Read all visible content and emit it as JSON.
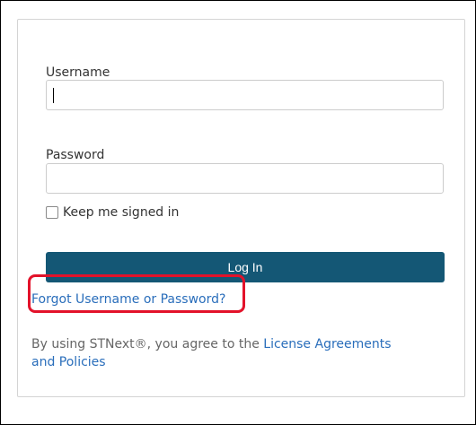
{
  "login": {
    "username_label": "Username",
    "username_value": "",
    "password_label": "Password",
    "password_value": "",
    "keep_signed_in_label": "Keep me signed in",
    "login_button_label": "Log In",
    "forgot_link_label": "Forgot Username or Password?",
    "agreement_text": "By using STNext®, you agree to the ",
    "agreement_link_label": "License Agreements and Policies"
  },
  "colors": {
    "button_background": "#145775",
    "link": "#2a6ebb",
    "highlight": "#e3122a"
  }
}
